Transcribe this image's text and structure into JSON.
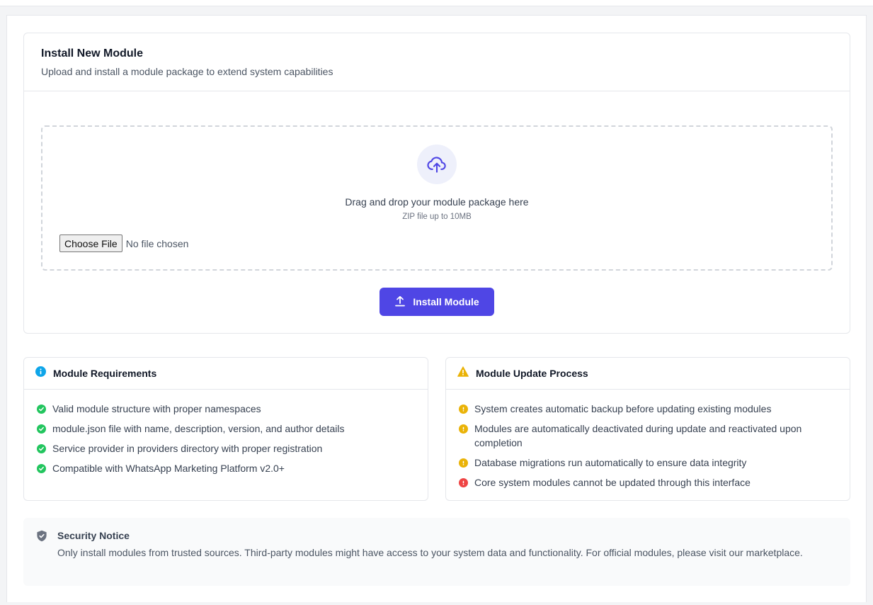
{
  "install": {
    "title": "Install New Module",
    "subtitle": "Upload and install a module package to extend system capabilities",
    "drop_title": "Drag and drop your module package here",
    "drop_hint": "ZIP file up to 10MB",
    "file_button": "Choose File",
    "file_status": "No file chosen",
    "install_button": "Install Module"
  },
  "requirements": {
    "title": "Module Requirements",
    "items": [
      "Valid module structure with proper namespaces",
      "module.json file with name, description, version, and author details",
      "Service provider in providers directory with proper registration",
      "Compatible with WhatsApp Marketing Platform v2.0+"
    ]
  },
  "update": {
    "title": "Module Update Process",
    "items": [
      "System creates automatic backup before updating existing modules",
      "Modules are automatically deactivated during update and reactivated upon completion",
      "Database migrations run automatically to ensure data integrity",
      "Core system modules cannot be updated through this interface"
    ]
  },
  "security": {
    "title": "Security Notice",
    "text": "Only install modules from trusted sources. Third-party modules might have access to your system data and functionality. For official modules, please visit our marketplace."
  },
  "colors": {
    "accent": "#4f46e5",
    "success": "#22c55e",
    "warning": "#eab308",
    "danger": "#ef4444",
    "info": "#0ea5e9"
  },
  "icons": {
    "upload": "cloud-upload-icon",
    "install": "upload-arrow-icon",
    "requirements": "info-circle-icon",
    "update": "warning-triangle-icon",
    "security": "shield-check-icon"
  }
}
